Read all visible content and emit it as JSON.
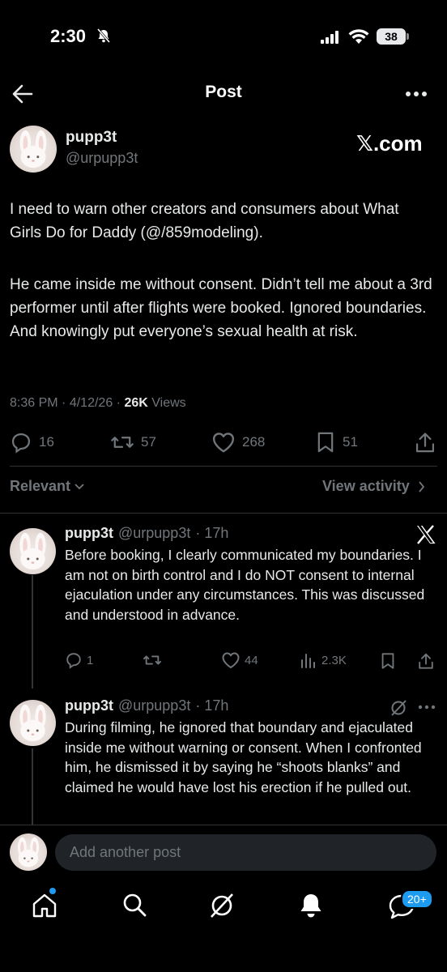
{
  "status_bar": {
    "time": "2:30",
    "battery": "38"
  },
  "header": {
    "title": "Post"
  },
  "brand": {
    "label": "𝕏.com"
  },
  "post": {
    "author_name": "pupp3t",
    "author_handle": "@urpupp3t",
    "paragraph_1": "I need to warn other creators and consumers about What Girls Do for Daddy (@/859modeling).",
    "paragraph_2": "He came inside me without consent. Didn’t tell me about a 3rd performer until after flights were booked. Ignored boundaries. And knowingly put everyone’s sexual health at risk.",
    "time": "8:36 PM",
    "date": "4/12/26",
    "views_count": "26K",
    "views_label": "Views",
    "replies": "16",
    "reposts": "57",
    "likes": "268",
    "bookmarks": "51"
  },
  "filter": {
    "relevant_label": "Relevant",
    "view_activity_label": "View activity"
  },
  "replies": [
    {
      "name": "pupp3t",
      "handle": "@urpupp3t",
      "age": "· 17h",
      "text": "Before booking, I clearly communicated my boundaries. I am not on birth control and I do NOT consent to internal ejaculation under any circumstances. This was discussed and understood in advance.",
      "reply_count": "1",
      "repost_count": "",
      "like_count": "44",
      "view_count": "2.3K"
    },
    {
      "name": "pupp3t",
      "handle": "@urpupp3t",
      "age": "· 17h",
      "text": "During filming, he ignored that boundary and ejaculated inside me without warning or consent. When I confronted him, he dismissed it by saying he “shoots blanks” and claimed he would have lost his erection if he pulled out."
    }
  ],
  "compose": {
    "placeholder": "Add another post"
  },
  "tabbar": {
    "notifications_badge": "20+"
  },
  "colors": {
    "background": "#000000",
    "text": "#e7e9ea",
    "muted": "#71767b",
    "accent": "#1d9bf0",
    "divider": "#2f3336"
  }
}
